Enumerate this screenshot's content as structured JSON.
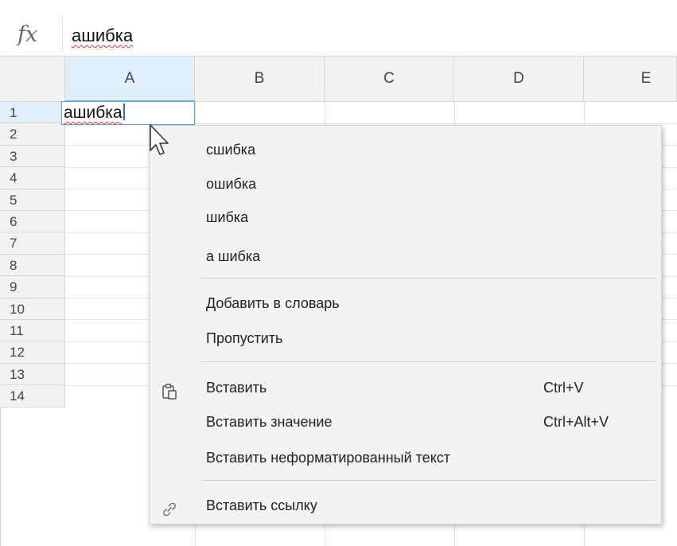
{
  "formula_bar": {
    "fx_label": "fx",
    "value": "ашибка"
  },
  "grid": {
    "columns": [
      "A",
      "B",
      "C",
      "D",
      "E"
    ],
    "selected_column": "A",
    "rows": [
      "1",
      "2",
      "3",
      "4",
      "5",
      "6",
      "7",
      "8",
      "9",
      "10",
      "11",
      "12",
      "13",
      "14"
    ],
    "selected_row": "1",
    "active_cell_value": "ашибка"
  },
  "context_menu": {
    "suggestions": [
      "сшибка",
      "ошибка",
      "шибка",
      "а шибка"
    ],
    "spell_actions": [
      "Добавить в словарь",
      "Пропустить"
    ],
    "paste_actions": [
      {
        "label": "Вставить",
        "shortcut": "Ctrl+V",
        "icon": "clipboard-icon"
      },
      {
        "label": "Вставить значение",
        "shortcut": "Ctrl+Alt+V"
      },
      {
        "label": "Вставить неформатированный текст",
        "shortcut": ""
      }
    ],
    "link_action": {
      "label": "Вставить ссылку",
      "icon": "link-icon"
    }
  },
  "colors": {
    "selection_header": "#dfeefb",
    "active_border": "#5aa0e0",
    "spell_error": "#dd3333",
    "menu_background": "#f3f3f3"
  }
}
